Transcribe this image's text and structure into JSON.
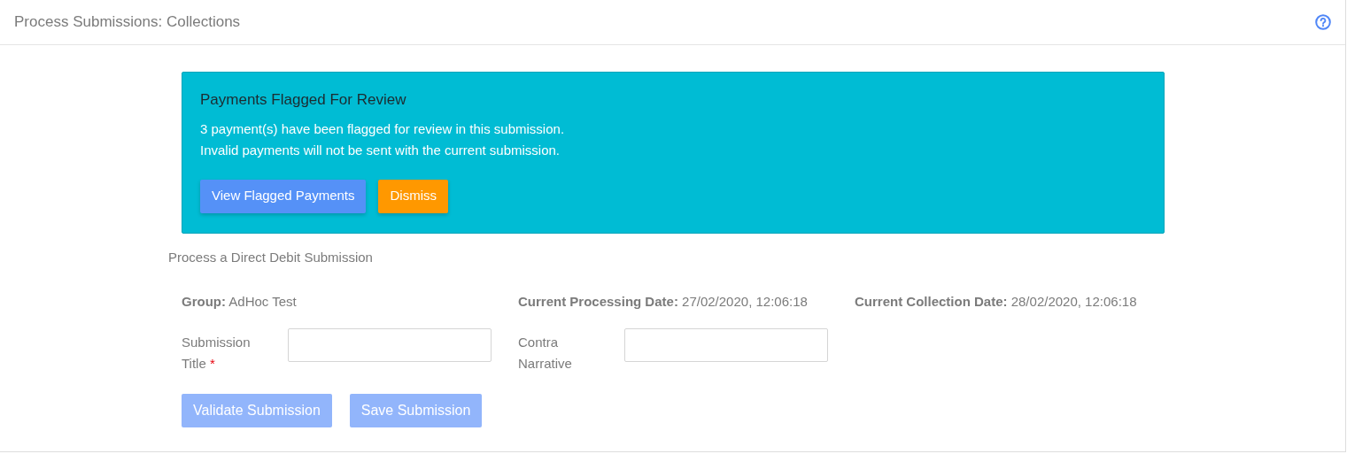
{
  "header": {
    "title": "Process Submissions: Collections"
  },
  "alert": {
    "title": "Payments Flagged For Review",
    "lines": [
      "3 payment(s) have been flagged for review in this submission.",
      "Invalid payments will not be sent with the current submission."
    ],
    "buttons": [
      {
        "label": "View Flagged Payments",
        "kind": "primary"
      },
      {
        "label": "Dismiss",
        "kind": "warning"
      }
    ]
  },
  "section_title": "Process a Direct Debit Submission",
  "info": [
    {
      "label": "Group:",
      "value": "AdHoc Test"
    },
    {
      "label": "Current Processing Date:",
      "value": "27/02/2020, 12:06:18"
    },
    {
      "label": "Current Collection Date:",
      "value": "28/02/2020, 12:06:18"
    }
  ],
  "fields": [
    {
      "label": "Submission Title",
      "required_mark": "*"
    },
    {
      "label": "Contra Narrative"
    }
  ],
  "actions": [
    {
      "label": "Validate Submission",
      "disabled": true
    },
    {
      "label": "Save Submission",
      "disabled": true
    }
  ]
}
